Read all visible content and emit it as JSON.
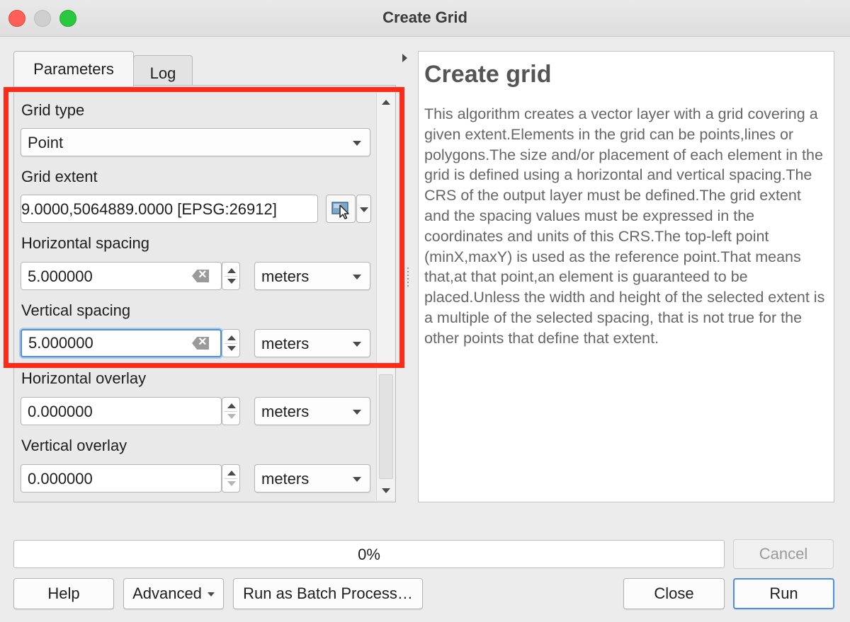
{
  "window": {
    "title": "Create Grid"
  },
  "tabs": [
    {
      "label": "Parameters"
    },
    {
      "label": "Log"
    }
  ],
  "params": {
    "grid_type": {
      "label": "Grid type",
      "value": "Point"
    },
    "grid_extent": {
      "label": "Grid extent",
      "value": "9.0000,5064889.0000 [EPSG:26912]"
    },
    "horizontal_spacing": {
      "label": "Horizontal spacing",
      "value": "5.000000",
      "unit": "meters"
    },
    "vertical_spacing": {
      "label": "Vertical spacing",
      "value": "5.000000",
      "unit": "meters"
    },
    "horizontal_overlay": {
      "label": "Horizontal overlay",
      "value": "0.000000",
      "unit": "meters"
    },
    "vertical_overlay": {
      "label": "Vertical overlay",
      "value": "0.000000",
      "unit": "meters"
    }
  },
  "help": {
    "title": "Create grid",
    "body": "This algorithm creates a vector layer with a grid covering a given extent.Elements in the grid can be points,lines or polygons.The size and/or placement of each element in the grid is defined using a horizontal and vertical spacing.The CRS of the output layer must be defined.The grid extent and the spacing values must be expressed in the coordinates and units of this CRS.The top-left point (minX,maxY) is used as the reference point.That means that,at that point,an element is guaranteed to be placed.Unless the width and height of the selected extent is a multiple of the selected spacing, that is not true for the other points that define that extent."
  },
  "progress": {
    "value": 0,
    "label": "0%"
  },
  "buttons": {
    "cancel": "Cancel",
    "help": "Help",
    "advanced": "Advanced",
    "batch": "Run as Batch Process…",
    "close": "Close",
    "run": "Run"
  },
  "colors": {
    "highlight": "#ff2a1a",
    "focus": "#4d8fe0"
  }
}
